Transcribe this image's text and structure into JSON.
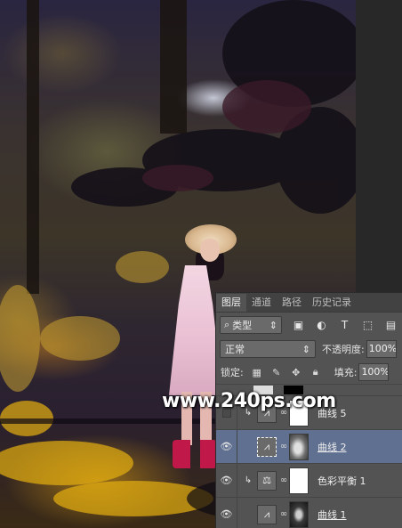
{
  "panel": {
    "tabs": [
      "图层",
      "通道",
      "路径",
      "历史记录"
    ],
    "filter": {
      "kind_label": "类型",
      "search_icon": "search-icon",
      "icons": [
        "image-filter-icon",
        "adjustment-filter-icon",
        "type-filter-icon",
        "shape-filter-icon",
        "smart-object-filter-icon"
      ]
    },
    "blend_mode": "正常",
    "opacity_label": "不透明度:",
    "opacity_value": "100%",
    "lock_label": "锁定:",
    "lock_icons": [
      "lock-transparent-icon",
      "lock-image-icon",
      "lock-position-icon",
      "lock-all-icon"
    ],
    "fill_label": "填充:",
    "fill_value": "100%",
    "layers": [
      {
        "name": "曲线 5",
        "visible": false,
        "clipped": true,
        "selected": false,
        "icon": "curves-icon"
      },
      {
        "name": "曲线 2",
        "visible": true,
        "clipped": false,
        "selected": true,
        "icon": "curves-icon"
      },
      {
        "name": "色彩平衡 1",
        "visible": true,
        "clipped": true,
        "selected": false,
        "icon": "color-balance-icon"
      },
      {
        "name": "曲线 1",
        "visible": true,
        "clipped": false,
        "selected": false,
        "icon": "curves-icon"
      }
    ]
  },
  "watermark": "www.240ps.com",
  "colors": {
    "panel_bg": "#535353",
    "selected_layer": "#607090",
    "canvas_bg": "#282828"
  }
}
